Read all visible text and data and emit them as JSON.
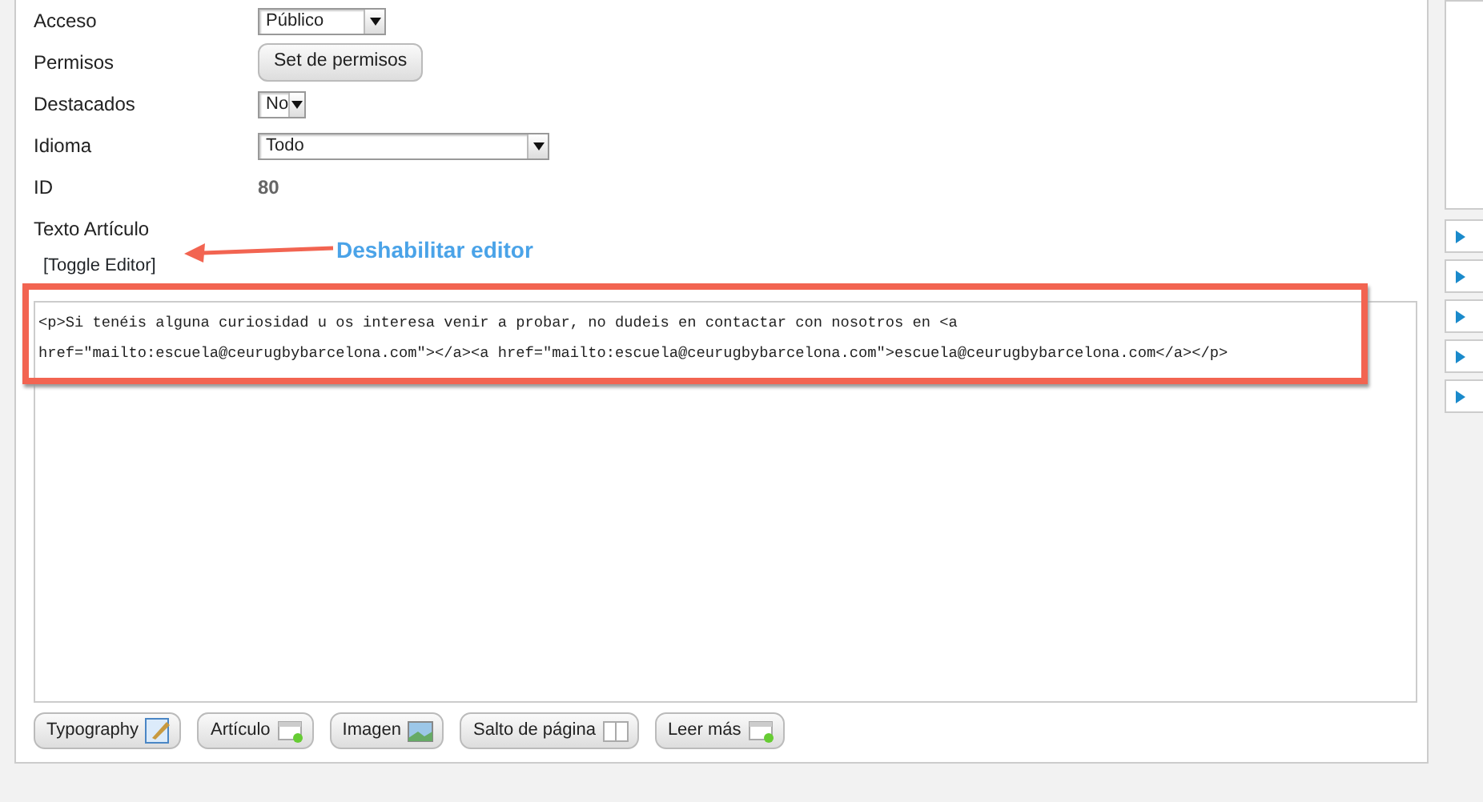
{
  "form_rows": [
    {
      "label": "Acceso",
      "kind": "select",
      "value": "Público"
    },
    {
      "label": "Permisos",
      "kind": "button",
      "value": "Set de permisos"
    },
    {
      "label": "Destacados",
      "kind": "select",
      "value": "No"
    },
    {
      "label": "Idioma",
      "kind": "select",
      "value": "Todo"
    },
    {
      "label": "ID",
      "kind": "static",
      "value": "80"
    },
    {
      "label": "Texto Artículo",
      "kind": "none"
    }
  ],
  "toggle_editor": "[Toggle Editor]",
  "annotation": "Deshabilitar editor",
  "editor": {
    "lines": [
      "<p>Si tenéis alguna curiosidad u os interesa venir a probar, no dudeis en contactar con nosotros en <a",
      "href=\"mailto:escuela@ceurugbybarcelona.com\"></a><a href=\"mailto:escuela@ceurugbybarcelona.com\">escuela@ceurugbybarcelona.com</a></p>"
    ]
  },
  "editor_buttons": [
    {
      "label": "Typography"
    },
    {
      "label": "Artículo"
    },
    {
      "label": "Imagen"
    },
    {
      "label": "Salto de página"
    },
    {
      "label": "Leer más"
    }
  ],
  "side_panels": [
    {
      "expanded": false
    },
    {
      "expanded": false
    },
    {
      "expanded": false
    },
    {
      "expanded": false
    },
    {
      "expanded": false
    }
  ]
}
